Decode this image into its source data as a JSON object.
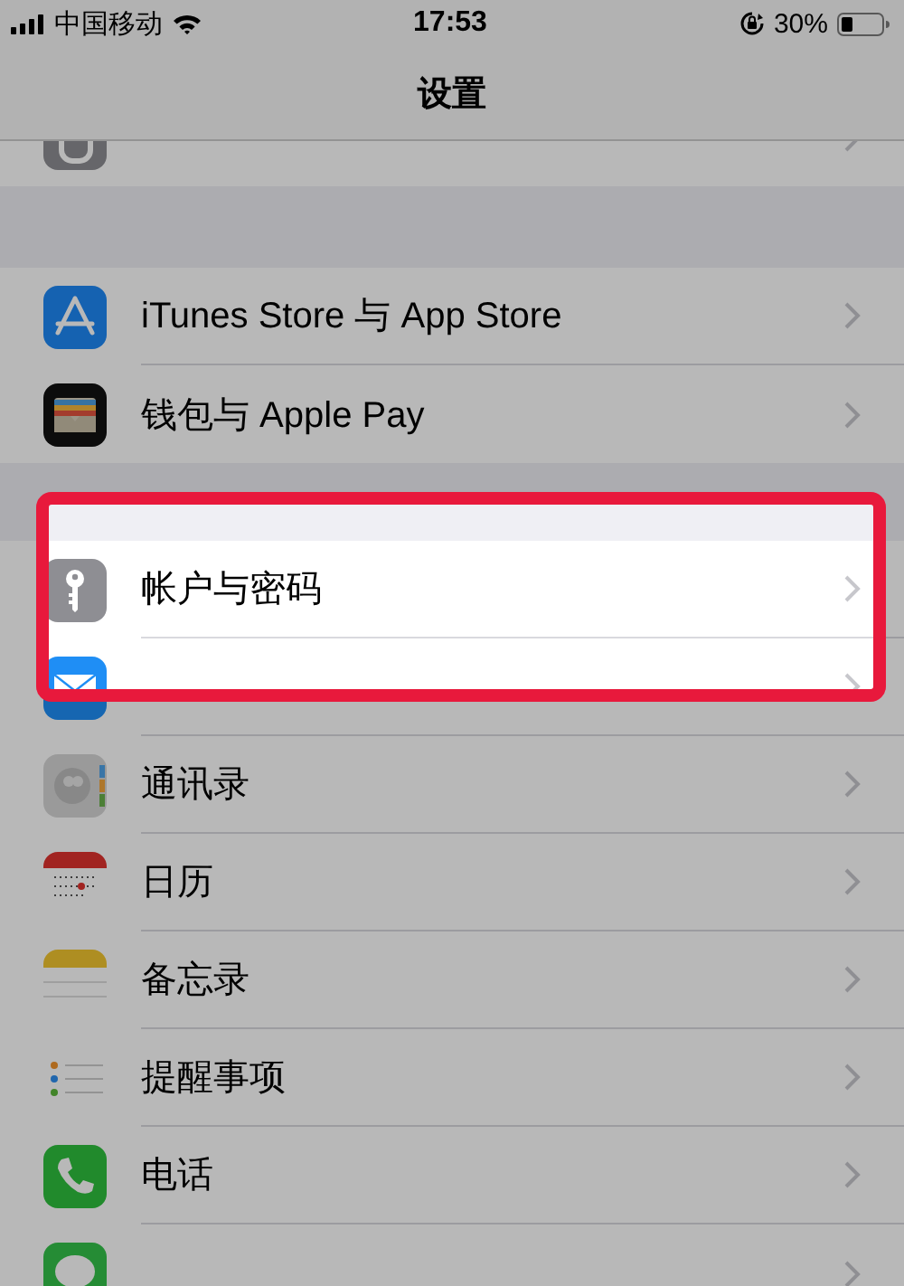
{
  "status_bar": {
    "carrier": "中国移动",
    "time": "17:53",
    "battery": "30%"
  },
  "nav": {
    "title": "设置"
  },
  "groups": [
    {
      "rows": [
        {
          "highlighted": false
        }
      ]
    },
    {
      "rows": [
        {
          "label": "iTunes Store 与 App Store",
          "highlighted": false
        },
        {
          "label": "钱包与 Apple Pay",
          "highlighted": false
        }
      ]
    },
    {
      "rows": [
        {
          "label": "帐户与密码",
          "highlighted": true
        },
        {
          "highlighted": false
        },
        {
          "label": "通讯录",
          "highlighted": false
        },
        {
          "label": "日历",
          "highlighted": false
        },
        {
          "label": "备忘录",
          "highlighted": false
        },
        {
          "label": "提醒事项",
          "highlighted": false
        },
        {
          "label": "电话",
          "highlighted": false
        },
        {
          "highlighted": false
        }
      ]
    }
  ]
}
